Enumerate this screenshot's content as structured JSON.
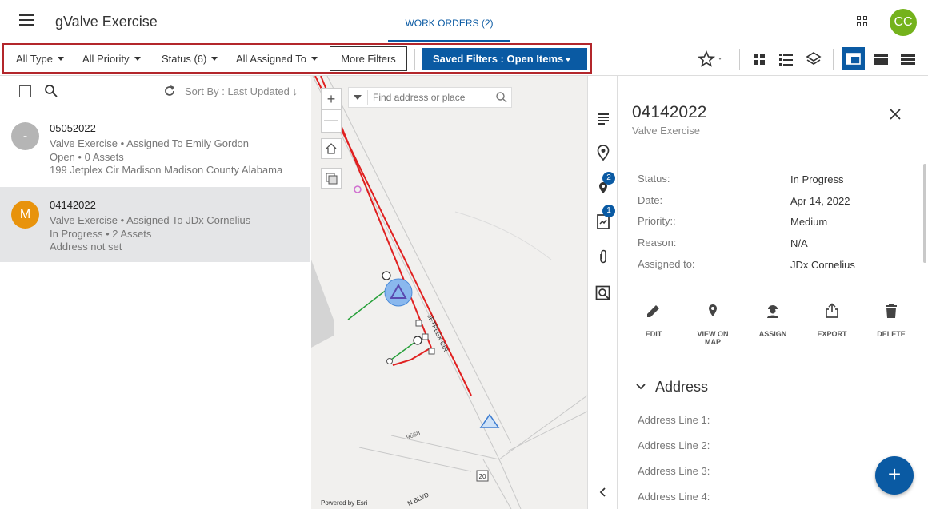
{
  "app": {
    "title": "gValve Exercise",
    "avatar_initials": "CC",
    "avatar_color": "#74b21c",
    "accent": "#0a5aa3"
  },
  "tabs": [
    {
      "label": "WORK ORDERS (2)",
      "active": true
    }
  ],
  "filters": {
    "type": "All Type",
    "priority": "All Priority",
    "status": "Status (6)",
    "assigned": "All Assigned To",
    "more": "More Filters",
    "saved": "Saved Filters : Open Items"
  },
  "list": {
    "sort_label": "Sort By : Last Updated",
    "items": [
      {
        "initial": "-",
        "avatar_color": "#b5b5b5",
        "id": "05052022",
        "line2": "Valve Exercise • Assigned To Emily Gordon",
        "line3": "Open • 0 Assets",
        "line4": "199 Jetplex Cir Madison Madison County Alabama",
        "selected": false
      },
      {
        "initial": "M",
        "avatar_color": "#e8930c",
        "id": "04142022",
        "line2": "Valve Exercise • Assigned To JDx Cornelius",
        "line3": "In Progress • 2 Assets",
        "line4": "Address not set",
        "selected": true
      }
    ]
  },
  "map": {
    "search_placeholder": "Find address or place",
    "powered_by": "Powered by Esri",
    "labels": {
      "street1": "JETPLEX CIR",
      "street2": "9668",
      "street3": "N BLVD",
      "shield": "20"
    }
  },
  "sidebar": {
    "badge_location": "2",
    "badge_forms": "1"
  },
  "detail": {
    "id": "04142022",
    "subtitle": "Valve Exercise",
    "fields": [
      {
        "label": "Status:",
        "value": "In Progress"
      },
      {
        "label": "Date:",
        "value": "Apr 14, 2022"
      },
      {
        "label": "Priority::",
        "value": "Medium"
      },
      {
        "label": "Reason:",
        "value": "N/A"
      },
      {
        "label": "Assigned to:",
        "value": "JDx Cornelius"
      }
    ],
    "actions": [
      "EDIT",
      "VIEW ON MAP",
      "ASSIGN",
      "EXPORT",
      "DELETE"
    ],
    "address_section": "Address",
    "address_lines": [
      "Address Line 1:",
      "Address Line 2:",
      "Address Line 3:",
      "Address Line 4:"
    ]
  }
}
